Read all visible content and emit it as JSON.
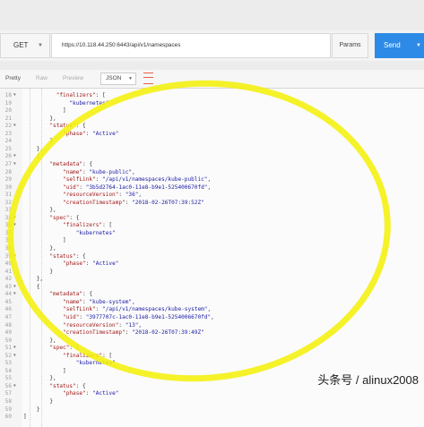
{
  "request": {
    "method": "GET",
    "url": "https://10.118.44.250:6443/api/v1/namespaces",
    "params_label": "Params",
    "send_label": "Send"
  },
  "response_tabs": {
    "pretty": "Pretty",
    "raw": "Raw",
    "preview": "Preview",
    "format": "JSON"
  },
  "colors": {
    "send_button": "#2d8ae6",
    "json_key": "#a11a1a",
    "json_string": "#1a1aa6",
    "highlight": "#f4f00c"
  },
  "code_lines": [
    {
      "n": "18",
      "fold": true,
      "indent": 10,
      "key": "\"finalizers\"",
      "rest": ": ["
    },
    {
      "n": "19",
      "fold": false,
      "indent": 14,
      "str": "\"kubernetes\""
    },
    {
      "n": "20",
      "fold": false,
      "indent": 12,
      "rest": "]"
    },
    {
      "n": "21",
      "fold": false,
      "indent": 8,
      "rest": "},"
    },
    {
      "n": "22",
      "fold": true,
      "indent": 8,
      "key": "\"status\"",
      "rest": ": {"
    },
    {
      "n": "23",
      "fold": false,
      "indent": 12,
      "key": "\"phase\"",
      "rest": ": ",
      "str": "\"Active\""
    },
    {
      "n": "24",
      "fold": false,
      "indent": 8,
      "rest": "}"
    },
    {
      "n": "25",
      "fold": false,
      "indent": 4,
      "rest": "},"
    },
    {
      "n": "26",
      "fold": true,
      "indent": 4,
      "rest": "{"
    },
    {
      "n": "27",
      "fold": true,
      "indent": 8,
      "key": "\"metadata\"",
      "rest": ": {"
    },
    {
      "n": "28",
      "fold": false,
      "indent": 12,
      "key": "\"name\"",
      "rest": ": ",
      "str": "\"kube-public\","
    },
    {
      "n": "29",
      "fold": false,
      "indent": 12,
      "key": "\"selfLink\"",
      "rest": ": ",
      "str": "\"/api/v1/namespaces/kube-public\","
    },
    {
      "n": "30",
      "fold": false,
      "indent": 12,
      "key": "\"uid\"",
      "rest": ": ",
      "str": "\"3b5d2764-1ac0-11e8-b9e1-525400670fd\","
    },
    {
      "n": "31",
      "fold": false,
      "indent": 12,
      "key": "\"resourceVersion\"",
      "rest": ": ",
      "str": "\"36\","
    },
    {
      "n": "32",
      "fold": false,
      "indent": 12,
      "key": "\"creationTimestamp\"",
      "rest": ": ",
      "str": "\"2018-02-26T07:39:52Z\""
    },
    {
      "n": "33",
      "fold": false,
      "indent": 8,
      "rest": "},"
    },
    {
      "n": "34",
      "fold": true,
      "indent": 8,
      "key": "\"spec\"",
      "rest": ": {"
    },
    {
      "n": "35",
      "fold": true,
      "indent": 12,
      "key": "\"finalizers\"",
      "rest": ": ["
    },
    {
      "n": "36",
      "fold": false,
      "indent": 16,
      "str": "\"kubernetes\""
    },
    {
      "n": "37",
      "fold": false,
      "indent": 12,
      "rest": "]"
    },
    {
      "n": "38",
      "fold": false,
      "indent": 8,
      "rest": "},"
    },
    {
      "n": "39",
      "fold": true,
      "indent": 8,
      "key": "\"status\"",
      "rest": ": {"
    },
    {
      "n": "40",
      "fold": false,
      "indent": 12,
      "key": "\"phase\"",
      "rest": ": ",
      "str": "\"Active\""
    },
    {
      "n": "41",
      "fold": false,
      "indent": 8,
      "rest": "}"
    },
    {
      "n": "42",
      "fold": false,
      "indent": 4,
      "rest": "},"
    },
    {
      "n": "43",
      "fold": true,
      "indent": 4,
      "rest": "{"
    },
    {
      "n": "44",
      "fold": true,
      "indent": 8,
      "key": "\"metadata\"",
      "rest": ": {"
    },
    {
      "n": "45",
      "fold": false,
      "indent": 12,
      "key": "\"name\"",
      "rest": ": ",
      "str": "\"kube-system\","
    },
    {
      "n": "46",
      "fold": false,
      "indent": 12,
      "key": "\"selfLink\"",
      "rest": ": ",
      "str": "\"/api/v1/namespaces/kube-system\","
    },
    {
      "n": "47",
      "fold": false,
      "indent": 12,
      "key": "\"uid\"",
      "rest": ": ",
      "str": "\"3977707c-1ac0-11e8-b9e1-5254006670fd\","
    },
    {
      "n": "48",
      "fold": false,
      "indent": 12,
      "key": "\"resourceVersion\"",
      "rest": ": ",
      "str": "\"13\","
    },
    {
      "n": "49",
      "fold": false,
      "indent": 12,
      "key": "\"creationTimestamp\"",
      "rest": ": ",
      "str": "\"2018-02-26T07:39:49Z\""
    },
    {
      "n": "50",
      "fold": false,
      "indent": 8,
      "rest": "},"
    },
    {
      "n": "51",
      "fold": true,
      "indent": 8,
      "key": "\"spec\"",
      "rest": ": {"
    },
    {
      "n": "52",
      "fold": true,
      "indent": 12,
      "key": "\"finalizers\"",
      "rest": ": ["
    },
    {
      "n": "53",
      "fold": false,
      "indent": 16,
      "str": "\"kubernetes\""
    },
    {
      "n": "54",
      "fold": false,
      "indent": 12,
      "rest": "]"
    },
    {
      "n": "55",
      "fold": false,
      "indent": 8,
      "rest": "},"
    },
    {
      "n": "56",
      "fold": true,
      "indent": 8,
      "key": "\"status\"",
      "rest": ": {"
    },
    {
      "n": "57",
      "fold": false,
      "indent": 12,
      "key": "\"phase\"",
      "rest": ": ",
      "str": "\"Active\""
    },
    {
      "n": "58",
      "fold": false,
      "indent": 8,
      "rest": "}"
    },
    {
      "n": "59",
      "fold": false,
      "indent": 4,
      "rest": "}"
    },
    {
      "n": "60",
      "fold": false,
      "indent": 0,
      "rest": "]"
    }
  ],
  "watermark": "头条号 / alinux2008"
}
